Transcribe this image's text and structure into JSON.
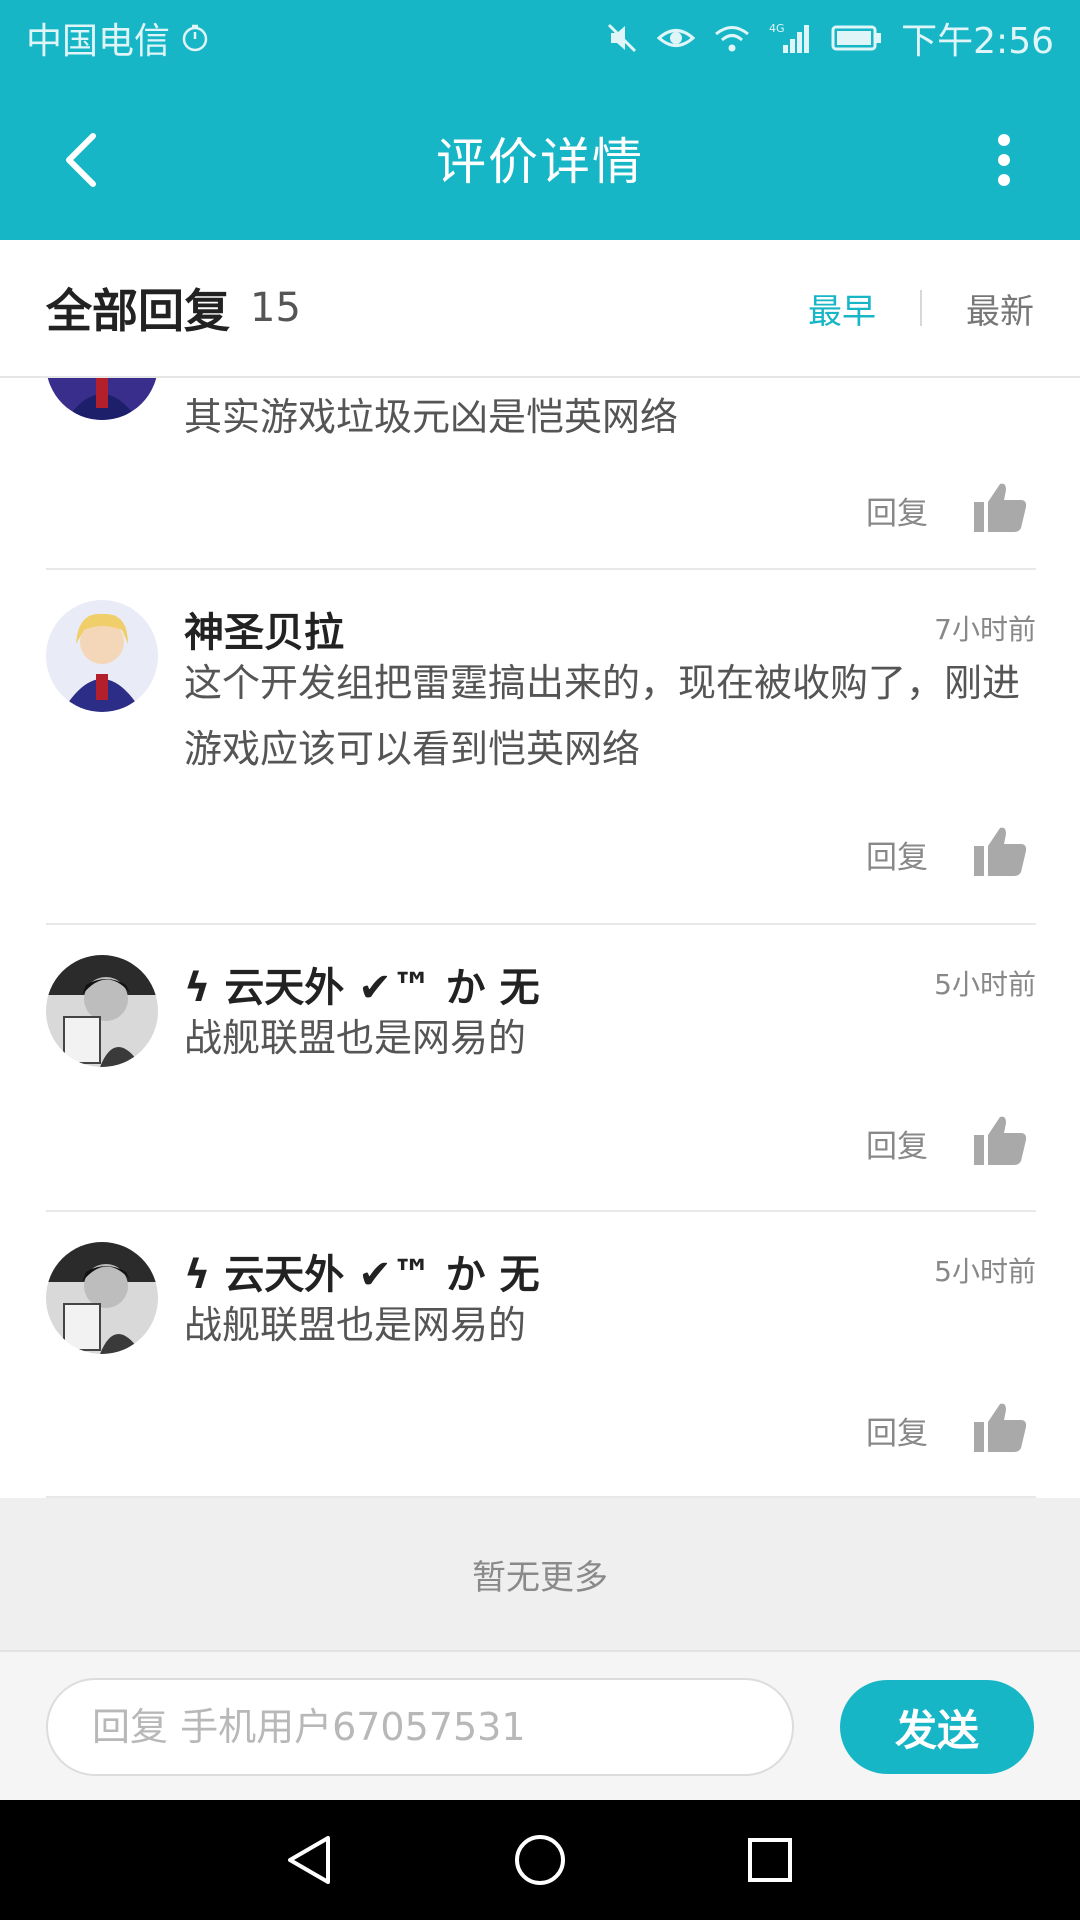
{
  "status_bar": {
    "carrier": "中国电信",
    "network": "4G",
    "time": "下午2:56",
    "icons": [
      "timer-icon",
      "mute-icon",
      "eye-icon",
      "wifi-icon",
      "signal-icon",
      "battery-icon"
    ]
  },
  "app_bar": {
    "title": "评价详情",
    "back_icon": "back-arrow-icon",
    "more_icon": "more-vert-icon"
  },
  "list_header": {
    "title": "全部回复",
    "count": "15",
    "sort_earliest": "最早",
    "sort_newest": "最新"
  },
  "comments": [
    {
      "name": "",
      "time": "",
      "content": "其实游戏垃圾元凶是恺英网络",
      "reply_label": "回复",
      "avatar": "anime-girl-avatar"
    },
    {
      "name": "神圣贝拉",
      "time": "7小时前",
      "content": "这个开发组把雷霆搞出来的，现在被收购了，刚进游戏应该可以看到恺英网络",
      "reply_label": "回复",
      "avatar": "anime-girl-avatar"
    },
    {
      "name": "ϟ 云天外 ✔™ か 无",
      "time": "5小时前",
      "content": "战舰联盟也是网易的",
      "reply_label": "回复",
      "avatar": "bw-reader-avatar"
    },
    {
      "name": "ϟ 云天外 ✔™ か 无",
      "time": "5小时前",
      "content": "战舰联盟也是网易的",
      "reply_label": "回复",
      "avatar": "bw-reader-avatar"
    }
  ],
  "no_more": "暂无更多",
  "reply_bar": {
    "placeholder": "回复 手机用户67057531",
    "send_label": "发送"
  },
  "nav_bar": {
    "icons": [
      "back-triangle-icon",
      "home-circle-icon",
      "recents-square-icon"
    ]
  },
  "colors": {
    "accent": "#17b6c6",
    "text_dark": "#222222",
    "text_muted": "#888888"
  }
}
